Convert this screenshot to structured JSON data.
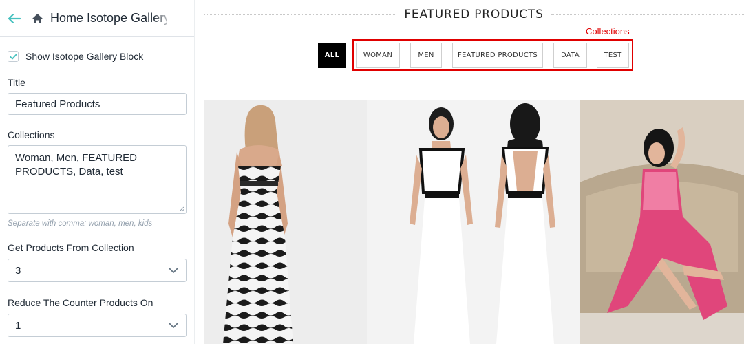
{
  "sidebar": {
    "title": "Home Isotope Gallery",
    "show_block_label": "Show Isotope Gallery Block",
    "show_block_checked": true,
    "title_label": "Title",
    "title_value": "Featured Products",
    "collections_label": "Collections",
    "collections_value": "Woman, Men, FEATURED PRODUCTS, Data, test",
    "collections_help": "Separate with comma: woman, men, kids",
    "get_products_label": "Get Products From Collection",
    "get_products_value": "3",
    "reduce_label": "Reduce The Counter Products On",
    "reduce_value": "1"
  },
  "main": {
    "heading": "FEATURED PRODUCTS",
    "annotation": "Collections",
    "filters": {
      "all": "ALL",
      "items": [
        "WOMAN",
        "MEN",
        "FEATURED PRODUCTS",
        "DATA",
        "TEST"
      ]
    }
  },
  "colors": {
    "accent": "#47c1bf",
    "annotation_red": "#e00000",
    "active_filter_bg": "#000000"
  },
  "icons": [
    "back-arrow-icon",
    "home-icon",
    "checkmark-icon",
    "chevron-down-icon"
  ]
}
